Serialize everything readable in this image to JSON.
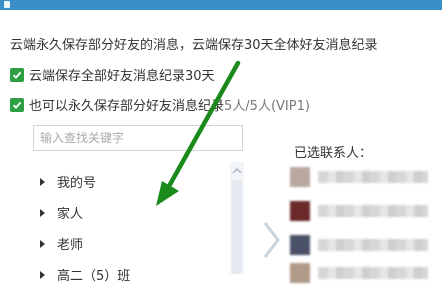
{
  "header": {
    "info_text": "云端永久保存部分好友的消息，云端保存30天全体好友消息纪录"
  },
  "options": [
    {
      "label": "云端保存全部好友消息纪录30天",
      "checked": true
    },
    {
      "label": "也可以永久保存部分好友消息纪录",
      "quota": "5人/5人(VIP1)",
      "checked": true
    }
  ],
  "search": {
    "placeholder": "输入查找关键字"
  },
  "tree": {
    "items": [
      {
        "label": "我的号"
      },
      {
        "label": "家人"
      },
      {
        "label": "老师"
      },
      {
        "label": "高二（5）班"
      }
    ]
  },
  "selected_panel": {
    "title": "已选联系人："
  },
  "colors": {
    "titlebar": "#3a8fc7",
    "checkbox": "#2e9f43",
    "annotation_arrow": "#1a8a1a"
  },
  "icons": {
    "checkbox": "checkbox-checked-icon",
    "tree_expand": "triangle-right-icon",
    "scroll_up": "chevron-up-icon",
    "transfer": "chevron-right-icon",
    "annotation": "green-arrow-icon"
  }
}
